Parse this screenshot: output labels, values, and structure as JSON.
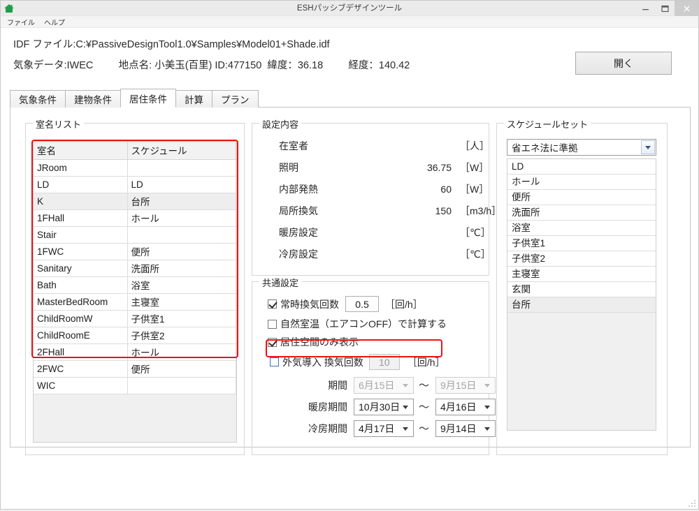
{
  "window": {
    "title": "ESHパッシブデザインツール",
    "icon": "house-icon",
    "minimize": "–",
    "maximize": "❐",
    "close": "✕"
  },
  "menubar": {
    "items": [
      {
        "label": "ファイル"
      },
      {
        "label": "ヘルプ"
      }
    ]
  },
  "header": {
    "idf_line": "IDF ファイル:C:¥PassiveDesignTool1.0¥Samples¥Model01+Shade.idf",
    "weather_line": "気象データ:IWEC         地点名: 小美玉(百里) ID:477150  緯度：36.18         経度：140.42",
    "open_button": "開く"
  },
  "tabs": [
    {
      "label": "気象条件",
      "active": false
    },
    {
      "label": "建物条件",
      "active": false
    },
    {
      "label": "居住条件",
      "active": true
    },
    {
      "label": "計算",
      "active": false
    },
    {
      "label": "プラン",
      "active": false
    }
  ],
  "rooms_group": {
    "title": "室名リスト",
    "columns": [
      "室名",
      "スケジュール"
    ],
    "rows": [
      {
        "name": "JRoom",
        "schedule": "",
        "selected": false
      },
      {
        "name": "LD",
        "schedule": "LD",
        "selected": false
      },
      {
        "name": "K",
        "schedule": "台所",
        "selected": true
      },
      {
        "name": "1FHall",
        "schedule": "ホール",
        "selected": false
      },
      {
        "name": "Stair",
        "schedule": "",
        "selected": false
      },
      {
        "name": "1FWC",
        "schedule": "便所",
        "selected": false
      },
      {
        "name": "Sanitary",
        "schedule": "洗面所",
        "selected": false
      },
      {
        "name": "Bath",
        "schedule": "浴室",
        "selected": false
      },
      {
        "name": "MasterBedRoom",
        "schedule": "主寝室",
        "selected": false
      },
      {
        "name": "ChildRoomW",
        "schedule": "子供室1",
        "selected": false
      },
      {
        "name": "ChildRoomE",
        "schedule": "子供室2",
        "selected": false
      },
      {
        "name": "2FHall",
        "schedule": "ホール",
        "selected": false
      },
      {
        "name": "2FWC",
        "schedule": "便所",
        "selected": false
      },
      {
        "name": "WIC",
        "schedule": "",
        "selected": false
      }
    ]
  },
  "settings_group": {
    "title": "設定内容",
    "rows": [
      {
        "label": "在室者",
        "value": "",
        "unit": "［人］"
      },
      {
        "label": "照明",
        "value": "36.75",
        "unit": "［W］"
      },
      {
        "label": "内部発熱",
        "value": "60",
        "unit": "［W］"
      },
      {
        "label": "局所換気",
        "value": "150",
        "unit": "［m3/h］"
      },
      {
        "label": "暖房設定",
        "value": "",
        "unit": "［℃］"
      },
      {
        "label": "冷房設定",
        "value": "",
        "unit": "［℃］"
      }
    ]
  },
  "common_group": {
    "title": "共通設定",
    "always_vent": {
      "label": "常時換気回数",
      "checked": true,
      "value": "0.5",
      "unit": "［回/h］"
    },
    "natural_temp": {
      "label": "自然室温（エアコンOFF）で計算する",
      "checked": false
    },
    "living_only": {
      "label": "居住空間のみ表示",
      "checked": true
    },
    "outside_air": {
      "label": "外気導入  換気回数",
      "checked": false,
      "value": "10",
      "unit": "［回/h］"
    },
    "periods": [
      {
        "label": "期間",
        "from": "6月15日",
        "to": "9月15日",
        "disabled": true
      },
      {
        "label": "暖房期間",
        "from": "10月30日",
        "to": "4月16日",
        "disabled": false
      },
      {
        "label": "冷房期間",
        "from": "4月17日",
        "to": "9月14日",
        "disabled": false
      }
    ],
    "separator": "〜"
  },
  "schedule_group": {
    "title": "スケジュールセット",
    "selected_set": "省エネ法に準拠",
    "items": [
      {
        "label": "LD",
        "selected": false
      },
      {
        "label": "ホール",
        "selected": false
      },
      {
        "label": "便所",
        "selected": false
      },
      {
        "label": "洗面所",
        "selected": false
      },
      {
        "label": "浴室",
        "selected": false
      },
      {
        "label": "子供室1",
        "selected": false
      },
      {
        "label": "子供室2",
        "selected": false
      },
      {
        "label": "主寝室",
        "selected": false
      },
      {
        "label": "玄関",
        "selected": false
      },
      {
        "label": "台所",
        "selected": true
      }
    ]
  },
  "annotations": {
    "color": "#ee1111",
    "room_list_box": "room-list-highlight",
    "outside_air_box": "outside-air-highlight"
  }
}
